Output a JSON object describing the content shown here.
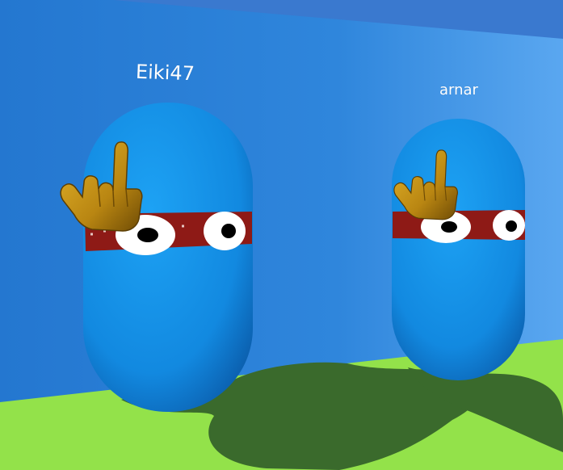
{
  "players": [
    {
      "name": "Eiki47",
      "gesture_icon": "middle-finger-icon"
    },
    {
      "name": "arnar",
      "gesture_icon": "middle-finger-icon"
    }
  ],
  "colors": {
    "wall": "#2f86dc",
    "wall_top": "#3b7fd3",
    "floor": "#93e24a",
    "shadow": "#3a6a2c",
    "capsule": "#1a8ee6",
    "headband": "#8e1a16",
    "hand": "#c08f18"
  }
}
